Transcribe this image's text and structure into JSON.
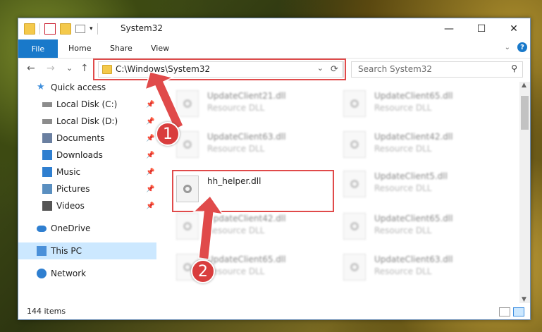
{
  "window": {
    "title": "System32",
    "minimize_glyph": "—",
    "maximize_glyph": "☐",
    "close_glyph": "✕"
  },
  "ribbon": {
    "file": "File",
    "home": "Home",
    "share": "Share",
    "view": "View",
    "expand_glyph": "⌄",
    "help_glyph": "?"
  },
  "navbar": {
    "back": "←",
    "forward": "→",
    "recent": "⌄",
    "up": "↑",
    "address": "C:\\Windows\\System32",
    "address_dropdown": "⌄",
    "refresh": "⟳",
    "search_placeholder": "Search System32",
    "search_icon": "⚲"
  },
  "sidebar": {
    "items": [
      {
        "label": "Quick access",
        "icon": "star-icon"
      },
      {
        "label": "Local Disk (C:)",
        "icon": "drive-icon"
      },
      {
        "label": "Local Disk (D:)",
        "icon": "drive-icon"
      },
      {
        "label": "Documents",
        "icon": "documents-icon"
      },
      {
        "label": "Downloads",
        "icon": "downloads-icon"
      },
      {
        "label": "Music",
        "icon": "music-icon"
      },
      {
        "label": "Pictures",
        "icon": "pictures-icon"
      },
      {
        "label": "Videos",
        "icon": "videos-icon"
      },
      {
        "label": "OneDrive",
        "icon": "cloud-icon"
      },
      {
        "label": "This PC",
        "icon": "computer-icon"
      },
      {
        "label": "Network",
        "icon": "network-icon"
      }
    ],
    "pin_glyph": "📌"
  },
  "files": [
    {
      "name": "UpdateClient21.dll",
      "type": "Resource DLL"
    },
    {
      "name": "UpdateClient65.dll",
      "type": "Resource DLL"
    },
    {
      "name": "UpdateClient63.dll",
      "type": "Resource DLL"
    },
    {
      "name": "UpdateClient42.dll",
      "type": "Resource DLL"
    },
    {
      "name": "hh_helper.dll",
      "type": ""
    },
    {
      "name": "UpdateClient5.dll",
      "type": "Resource DLL"
    },
    {
      "name": "UpdateClient42.dll",
      "type": "Resource DLL"
    },
    {
      "name": "UpdateClient65.dll",
      "type": "Resource DLL"
    },
    {
      "name": "UpdateClient65.dll",
      "type": "Resource DLL"
    },
    {
      "name": "UpdateClient63.dll",
      "type": "Resource DLL"
    }
  ],
  "status": {
    "count": "144 items"
  },
  "annotations": {
    "step1": "1",
    "step2": "2",
    "color": "#e04a4a"
  }
}
